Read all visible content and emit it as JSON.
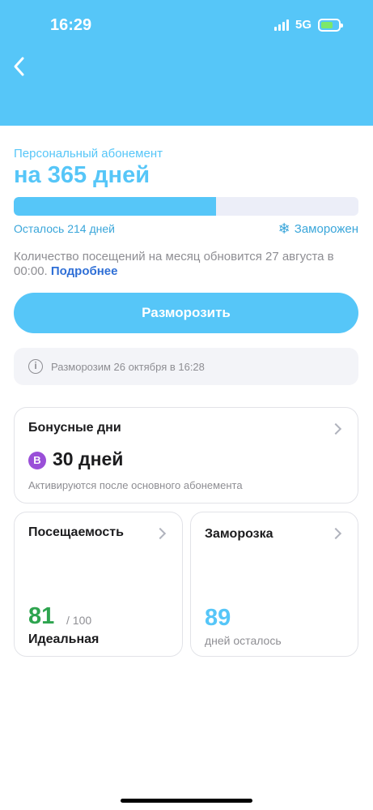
{
  "status_bar": {
    "time": "16:29",
    "network": "5G",
    "battery_icon": "battery-charging-icon",
    "signal_icon": "cellular-signal-icon"
  },
  "nav": {
    "back_icon": "chevron-left-icon"
  },
  "subscription": {
    "subtitle": "Персональный абонемент",
    "title": "на 365 дней",
    "progress_used_fraction": 0.587,
    "remaining": "Осталось 214 дней",
    "status_icon": "snowflake-icon",
    "status": "Заморожен",
    "visits_note": "Количество посещений на месяц обновится 27 августа в 00:00.",
    "more_link": "Подробнее"
  },
  "actions": {
    "unfreeze_label": "Разморозить"
  },
  "info": {
    "icon": "info-icon",
    "text": "Разморозим 26 октября в 16:28"
  },
  "bonus_card": {
    "title": "Бонусные дни",
    "badge": "B",
    "days": "30 дней",
    "note": "Активируются после основного абонемента"
  },
  "attendance_card": {
    "title": "Посещаемость",
    "score": "81",
    "total": "/ 100",
    "label": "Идеальная"
  },
  "freeze_card": {
    "title": "Заморозка",
    "days": "89",
    "label": "дней осталось"
  },
  "colors": {
    "accent": "#56c6f8",
    "link": "#2f6fd6",
    "success": "#2ea44f",
    "badge": "#9a4fd8",
    "muted": "#8e8e93"
  }
}
